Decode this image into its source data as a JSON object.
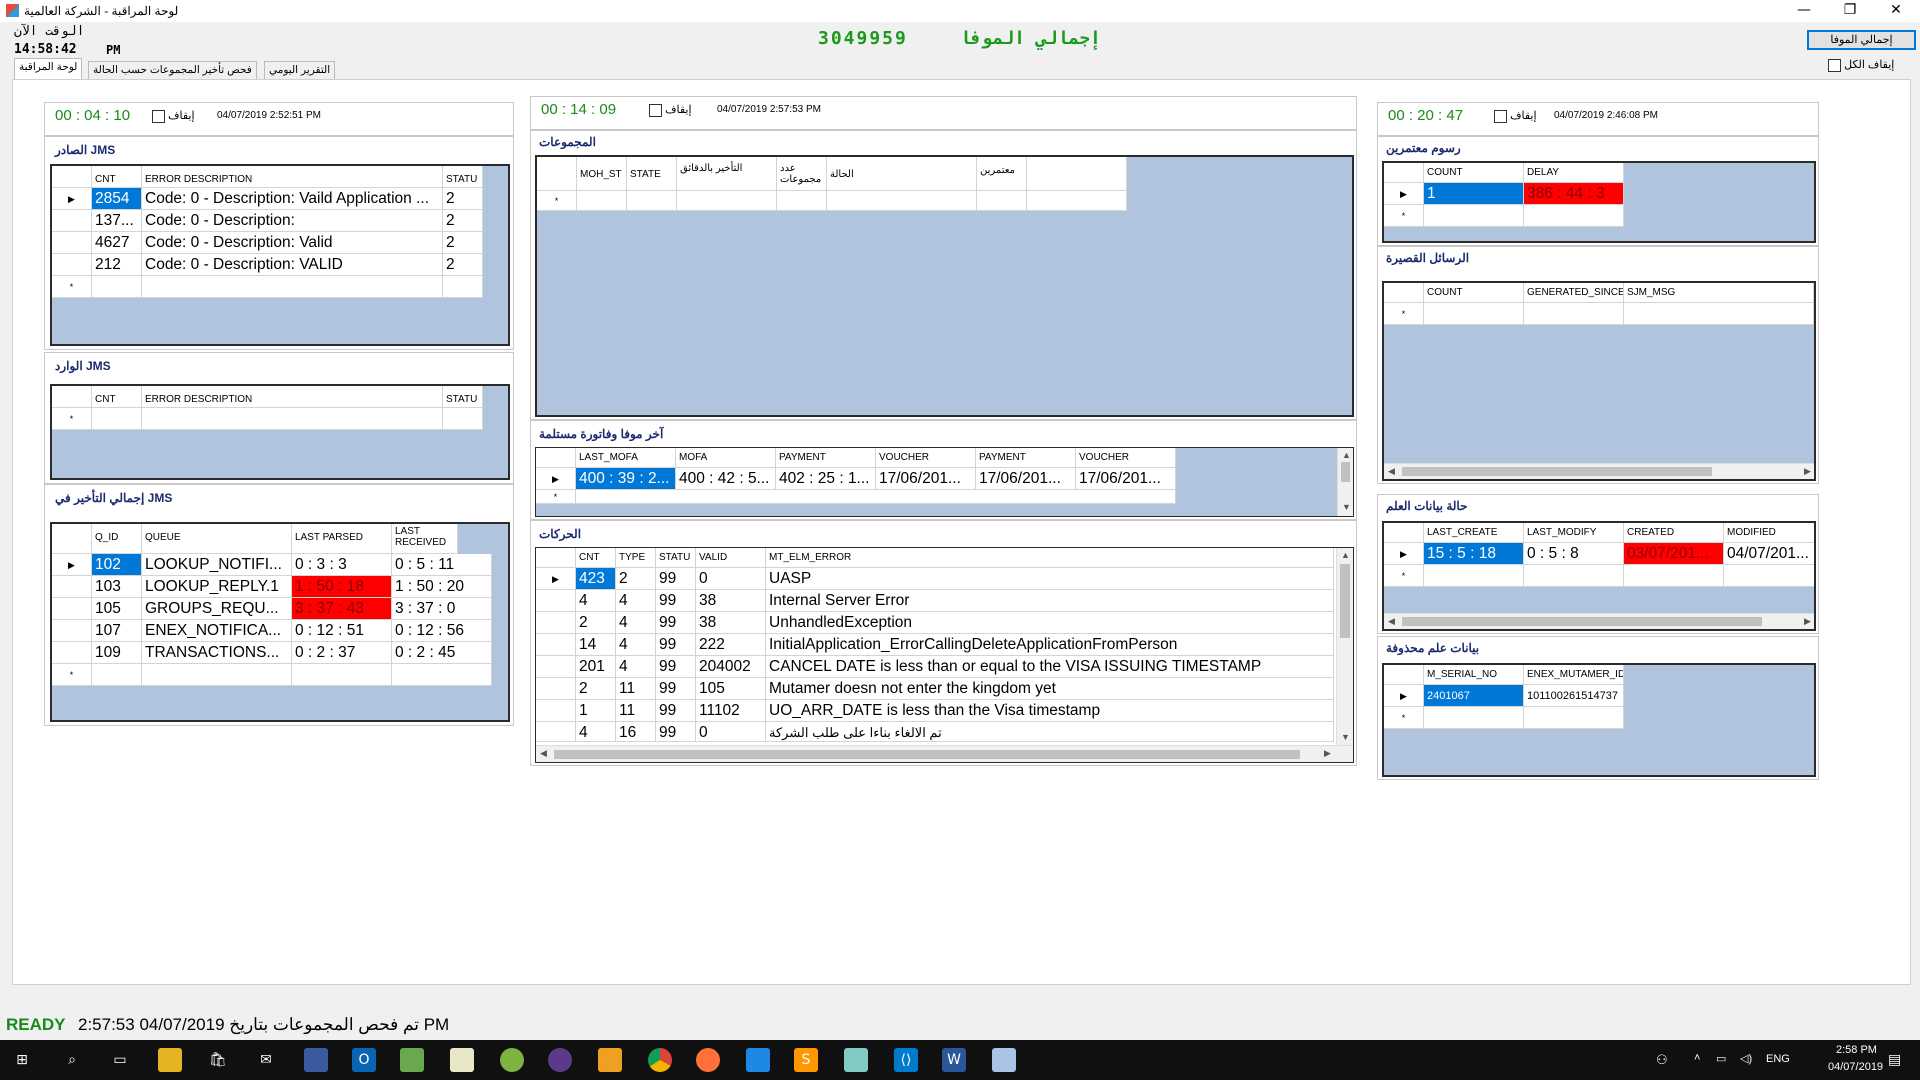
{
  "window": {
    "title": "لوحة المراقبة - الشركة العالمية",
    "min": "—",
    "max": "❐",
    "close": "✕"
  },
  "header": {
    "clock_label": "الوقت الآن",
    "clock_time": "14:58:42",
    "clock_ampm": "PM",
    "total_label": "إجمالي الموفا",
    "total_value": "3049959",
    "total_button": "إجمالي الموفا",
    "stop_all": "إيقاف الكل"
  },
  "tabs": [
    "لوحة المراقبة",
    "فحص تأخير المجموعات حسب الحالة",
    "التقرير اليومي"
  ],
  "stop_label": "إيقاف",
  "left": {
    "timer": "00 : 04 : 10",
    "timestamp": "04/07/2019 2:52:51 PM",
    "outgoing": {
      "title": "الصادر JMS",
      "headers": [
        "CNT",
        "ERROR DESCRIPTION",
        "STATU"
      ],
      "rows": [
        [
          "2854",
          "Code: 0 - Description: Vaild Application ...",
          "2"
        ],
        [
          "137...",
          "Code: 0 - Description:",
          "2"
        ],
        [
          "4627",
          "Code: 0 - Description: Valid",
          "2"
        ],
        [
          "212",
          "Code: 0 - Description: VALID",
          "2"
        ]
      ]
    },
    "incoming": {
      "title": "الوارد JMS",
      "headers": [
        "CNT",
        "ERROR DESCRIPTION",
        "STATU"
      ]
    },
    "delay": {
      "title": "إجمالي التأخير في JMS",
      "headers": [
        "Q_ID",
        "QUEUE",
        "LAST PARSED",
        "LAST RECEIVED"
      ],
      "rows": [
        [
          "102",
          "LOOKUP_NOTIFI...",
          "0 : 3 : 3",
          "0 : 5 : 11"
        ],
        [
          "103",
          "LOOKUP_REPLY.1",
          "1 : 50 : 18",
          "1 : 50 : 20"
        ],
        [
          "105",
          "GROUPS_REQU...",
          "3 : 37 : 43",
          "3 : 37 : 0"
        ],
        [
          "107",
          "ENEX_NOTIFICA...",
          "0 : 12 : 51",
          "0 : 12 : 56"
        ],
        [
          "109",
          "TRANSACTIONS...",
          "0 : 2 : 37",
          "0 : 2 : 45"
        ]
      ]
    }
  },
  "middle": {
    "timer": "00 : 14 : 09",
    "timestamp": "04/07/2019 2:57:53 PM",
    "groups": {
      "title": "المجموعات",
      "headers": [
        "MOH_ST",
        "STATE",
        "التأخير بالدقائق",
        "عدد مجموعات",
        "الحالة",
        "معتمرين"
      ]
    },
    "last_mofa": {
      "title": "آخر موفا وفاتورة مستلمة",
      "headers": [
        "LAST_MOFA",
        "MOFA",
        "PAYMENT",
        "VOUCHER",
        "PAYMENT",
        "VOUCHER"
      ],
      "row": [
        "400 : 39 : 2...",
        "400 : 42 : 5...",
        "402 : 25 : 1...",
        "17/06/201...",
        "17/06/201...",
        "17/06/201..."
      ]
    },
    "transactions": {
      "title": "الحركات",
      "headers": [
        "CNT",
        "TYPE",
        "STATU",
        "VALID",
        "MT_ELM_ERROR"
      ],
      "rows": [
        [
          "423",
          "2",
          "99",
          "0",
          "UASP"
        ],
        [
          "4",
          "4",
          "99",
          "38",
          "Internal Server Error"
        ],
        [
          "2",
          "4",
          "99",
          "38",
          "UnhandledException"
        ],
        [
          "14",
          "4",
          "99",
          "222",
          "InitialApplication_ErrorCallingDeleteApplicationFromPerson"
        ],
        [
          "201",
          "4",
          "99",
          "204002",
          "CANCEL DATE is less than or equal to the VISA ISSUING TIMESTAMP"
        ],
        [
          "2",
          "11",
          "99",
          "105",
          "Mutamer doesn not enter the kingdom yet"
        ],
        [
          "1",
          "11",
          "99",
          "11102",
          "UO_ARR_DATE is less than the Visa timestamp"
        ],
        [
          "4",
          "16",
          "99",
          "0",
          "تم الالغاء بناءا على طلب الشركة"
        ]
      ]
    }
  },
  "right": {
    "timer": "00 : 20 : 47",
    "timestamp": "04/07/2019 2:46:08 PM",
    "fees": {
      "title": "رسوم معتمرين",
      "headers": [
        "COUNT",
        "DELAY"
      ],
      "row": [
        "1",
        "386 : 44 : 3"
      ]
    },
    "sms": {
      "title": "الرسائل القصيرة",
      "headers": [
        "COUNT",
        "GENERATED_SINCE",
        "SJM_MSG"
      ]
    },
    "flag_status": {
      "title": "حالة بيانات العلم",
      "headers": [
        "LAST_CREATE",
        "LAST_MODIFY",
        "CREATED",
        "MODIFIED"
      ],
      "row": [
        "15 : 5 : 18",
        "0 : 5 : 8",
        "03/07/201...",
        "04/07/201..."
      ]
    },
    "deleted": {
      "title": "بيانات علم محذوفة",
      "headers": [
        "M_SERIAL_NO",
        "ENEX_MUTAMER_ID"
      ],
      "row": [
        "2401067",
        "101100261514737"
      ]
    }
  },
  "status": {
    "ready": "READY",
    "text": "2:57:53 04/07/2019 تم فحص المجموعات بتاريخ PM"
  },
  "taskbar": {
    "lang": "ENG",
    "time": "2:58 PM",
    "date": "04/07/2019",
    "icons": [
      "start-icon",
      "search-icon",
      "task-view-icon",
      "file-explorer-icon",
      "store-icon",
      "app-icon",
      "outlook-icon",
      "notepad-icon",
      "notes-icon",
      "app2-icon",
      "app3-icon",
      "app4-icon",
      "chrome-icon",
      "firefox-icon",
      "app5-icon",
      "sublime-icon",
      "app6-icon",
      "vscode-icon",
      "word-icon",
      "active-app-icon"
    ]
  }
}
